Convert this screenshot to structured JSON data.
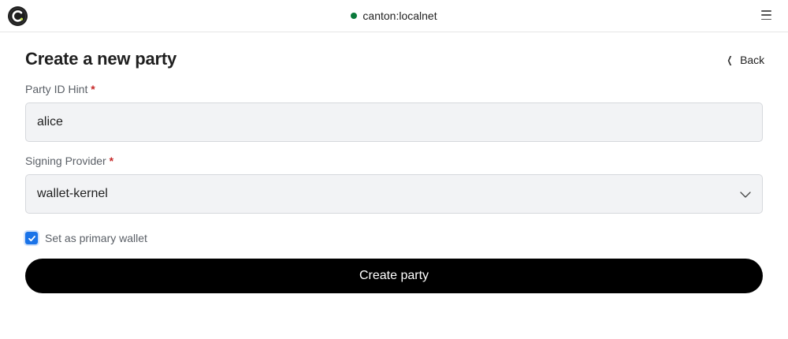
{
  "header": {
    "network_name": "canton:localnet",
    "status_color": "#0a7a3b",
    "logo_icon": "canton-logo-icon",
    "menu_icon": "hamburger-menu-icon"
  },
  "page": {
    "title": "Create a new party",
    "back_label": "Back"
  },
  "form": {
    "party_hint": {
      "label": "Party ID Hint",
      "required_mark": "*",
      "value": "alice"
    },
    "signing_provider": {
      "label": "Signing Provider",
      "required_mark": "*",
      "selected": "wallet-kernel"
    },
    "primary_wallet": {
      "label": "Set as primary wallet",
      "checked": true
    },
    "submit_label": "Create party"
  },
  "colors": {
    "accent": "#1a73e8",
    "button_bg": "#000000",
    "required": "#c62828"
  }
}
